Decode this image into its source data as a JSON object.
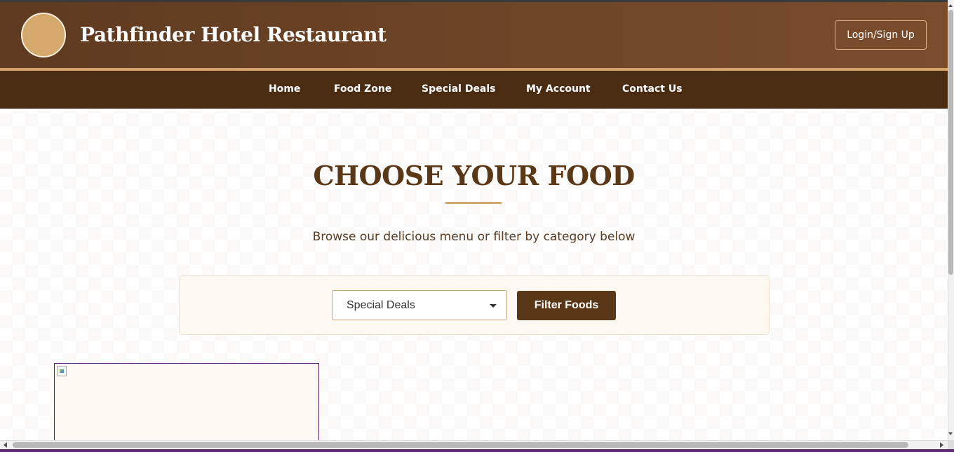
{
  "header": {
    "site_title": "Pathfinder Hotel Restaurant",
    "login_label": "Login/Sign Up"
  },
  "nav": {
    "items": [
      {
        "label": "Home"
      },
      {
        "label": "Food Zone"
      },
      {
        "label": "Special Deals"
      },
      {
        "label": "My Account"
      },
      {
        "label": "Contact Us"
      }
    ]
  },
  "main": {
    "heading": "CHOOSE YOUR FOOD",
    "subtitle": "Browse our delicious menu or filter by category below"
  },
  "filter": {
    "selected_category": "Special Deals",
    "button_label": "Filter Foods"
  },
  "colors": {
    "header_brown": "#6b4326",
    "nav_dark_brown": "#4a2c13",
    "accent_gold": "#d4a56a",
    "heading_brown": "#5a3716"
  },
  "icons": {
    "logo": "restaurant-logo-circle",
    "select_caret": "caret-down-icon",
    "food_image": "broken-image-icon"
  }
}
